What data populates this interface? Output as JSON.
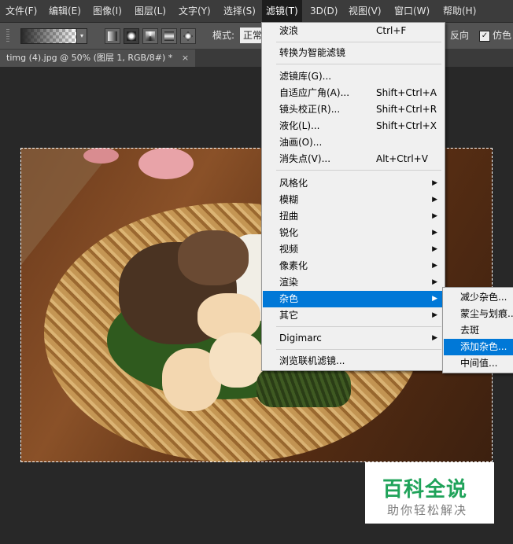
{
  "menubar": {
    "items": [
      {
        "label": "文件(F)"
      },
      {
        "label": "编辑(E)"
      },
      {
        "label": "图像(I)"
      },
      {
        "label": "图层(L)"
      },
      {
        "label": "文字(Y)"
      },
      {
        "label": "选择(S)"
      },
      {
        "label": "滤镜(T)"
      },
      {
        "label": "3D(D)"
      },
      {
        "label": "视图(V)"
      },
      {
        "label": "窗口(W)"
      },
      {
        "label": "帮助(H)"
      }
    ],
    "active_item": "滤镜(T)"
  },
  "optionsbar": {
    "gradient_dropdown": "▾",
    "mode_label": "模式:",
    "mode_value": "正常",
    "reverse_label": "反向",
    "reverse_checked": "✓",
    "dither_label": "仿色",
    "dither_checked": "✓"
  },
  "document_tab": {
    "title": "timg (4).jpg @ 50% (图层 1, RGB/8#) *",
    "close": "×"
  },
  "filter_menu": {
    "items": [
      {
        "label": "波浪",
        "shortcut": "Ctrl+F"
      },
      {
        "label": "转换为智能滤镜"
      },
      {
        "label": "滤镜库(G)..."
      },
      {
        "label": "自适应广角(A)...",
        "shortcut": "Shift+Ctrl+A"
      },
      {
        "label": "镜头校正(R)...",
        "shortcut": "Shift+Ctrl+R"
      },
      {
        "label": "液化(L)...",
        "shortcut": "Shift+Ctrl+X"
      },
      {
        "label": "油画(O)..."
      },
      {
        "label": "消失点(V)...",
        "shortcut": "Alt+Ctrl+V"
      },
      {
        "label": "风格化",
        "arrow": "▶"
      },
      {
        "label": "模糊",
        "arrow": "▶"
      },
      {
        "label": "扭曲",
        "arrow": "▶"
      },
      {
        "label": "锐化",
        "arrow": "▶"
      },
      {
        "label": "视频",
        "arrow": "▶"
      },
      {
        "label": "像素化",
        "arrow": "▶"
      },
      {
        "label": "渲染",
        "arrow": "▶"
      },
      {
        "label": "杂色",
        "arrow": "▶",
        "highlighted": true
      },
      {
        "label": "其它",
        "arrow": "▶"
      },
      {
        "label": "Digimarc",
        "arrow": "▶"
      },
      {
        "label": "浏览联机滤镜..."
      }
    ]
  },
  "noise_submenu": {
    "items": [
      {
        "label": "减少杂色..."
      },
      {
        "label": "蒙尘与划痕..."
      },
      {
        "label": "去斑"
      },
      {
        "label": "添加杂色...",
        "highlighted": true
      },
      {
        "label": "中间值..."
      }
    ]
  },
  "watermark": {
    "title": "百科全说",
    "subtitle": "助你轻松解决"
  },
  "colors": {
    "menu_highlight": "#0078d7",
    "watermark_green": "#20a35a"
  }
}
